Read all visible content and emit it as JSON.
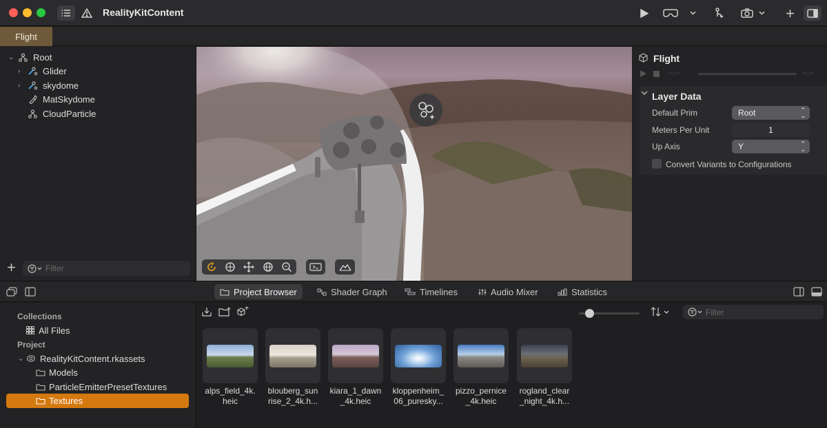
{
  "window": {
    "title": "RealityKitContent"
  },
  "tabs": [
    {
      "label": "Flight"
    }
  ],
  "hierarchy": {
    "items": [
      {
        "label": "Root"
      },
      {
        "label": "Glider"
      },
      {
        "label": "skydome"
      },
      {
        "label": "MatSkydome"
      },
      {
        "label": "CloudParticle"
      }
    ],
    "filter_placeholder": "Filter"
  },
  "inspector": {
    "title": "Flight",
    "time_start": "--:--",
    "time_end": "--:--",
    "section_title": "Layer Data",
    "default_prim_label": "Default Prim",
    "default_prim_value": "Root",
    "meters_per_unit_label": "Meters Per Unit",
    "meters_per_unit_value": "1",
    "up_axis_label": "Up Axis",
    "up_axis_value": "Y",
    "convert_variants_label": "Convert Variants to Configurations",
    "convert_variants_checked": false
  },
  "bottom_tabs": [
    {
      "label": "Project Browser",
      "active": true
    },
    {
      "label": "Shader Graph"
    },
    {
      "label": "Timelines"
    },
    {
      "label": "Audio Mixer"
    },
    {
      "label": "Statistics"
    }
  ],
  "project": {
    "collections_header": "Collections",
    "all_files": "All Files",
    "project_header": "Project",
    "package": "RealityKitContent.rkassets",
    "folders": [
      "Models",
      "ParticleEmitterPresetTextures",
      "Textures"
    ],
    "selected_folder": "Textures",
    "filter_placeholder": "Filter",
    "thumbnail_size": 0.12
  },
  "assets": [
    {
      "name": "alps_field_4k.\nheic"
    },
    {
      "name": "blouberg_sun\nrise_2_4k.h..."
    },
    {
      "name": "kiara_1_dawn\n_4k.heic"
    },
    {
      "name": "kloppenheim_\n06_puresky..."
    },
    {
      "name": "pizzo_pernice\n_4k.heic"
    },
    {
      "name": "rogland_clear\n_night_4k.h..."
    }
  ],
  "colors": {
    "accent_selection": "#d4790f",
    "tab_active": "#6e5a3a",
    "close": "#ff5f57",
    "minimize": "#febc2e",
    "zoom": "#28c840"
  }
}
